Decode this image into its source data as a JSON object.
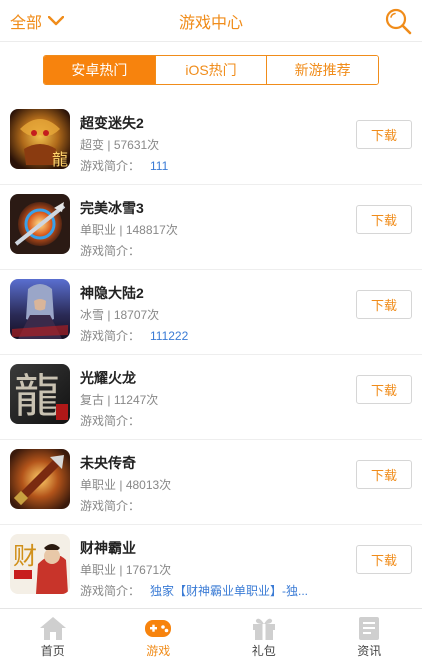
{
  "header": {
    "filter_label": "全部",
    "title": "游戏中心",
    "accent": "#f08c1a"
  },
  "tabs": [
    {
      "label": "安卓热门",
      "active": true
    },
    {
      "label": "iOS热门",
      "active": false
    },
    {
      "label": "新游推荐",
      "active": false
    }
  ],
  "games": [
    {
      "name": "超变迷失2",
      "category": "超变",
      "plays": "57631次",
      "intro_label": "游戏简介：",
      "intro": "111",
      "download": "下载",
      "thumb_text": "龍"
    },
    {
      "name": "完美冰雪3",
      "category": "单职业",
      "plays": "148817次",
      "intro_label": "游戏简介：",
      "intro": "",
      "download": "下载",
      "thumb_text": ""
    },
    {
      "name": "神隐大陆2",
      "category": "冰雪",
      "plays": "18707次",
      "intro_label": "游戏简介：",
      "intro": "111222",
      "download": "下载",
      "thumb_text": ""
    },
    {
      "name": "光耀火龙",
      "category": "复古",
      "plays": "11247次",
      "intro_label": "游戏简介：",
      "intro": "",
      "download": "下载",
      "thumb_text": "龍"
    },
    {
      "name": "未央传奇",
      "category": "单职业",
      "plays": "48013次",
      "intro_label": "游戏简介：",
      "intro": "",
      "download": "下载",
      "thumb_text": ""
    },
    {
      "name": "财神霸业",
      "category": "单职业",
      "plays": "17671次",
      "intro_label": "游戏简介：",
      "intro": "独家【财神霸业单职业】-独...",
      "download": "下载",
      "thumb_text": "财"
    }
  ],
  "tabbar": [
    {
      "label": "首页",
      "icon": "home-icon",
      "active": false
    },
    {
      "label": "游戏",
      "icon": "gamepad-icon",
      "active": true
    },
    {
      "label": "礼包",
      "icon": "gift-icon",
      "active": false
    },
    {
      "label": "资讯",
      "icon": "news-icon",
      "active": false
    }
  ]
}
